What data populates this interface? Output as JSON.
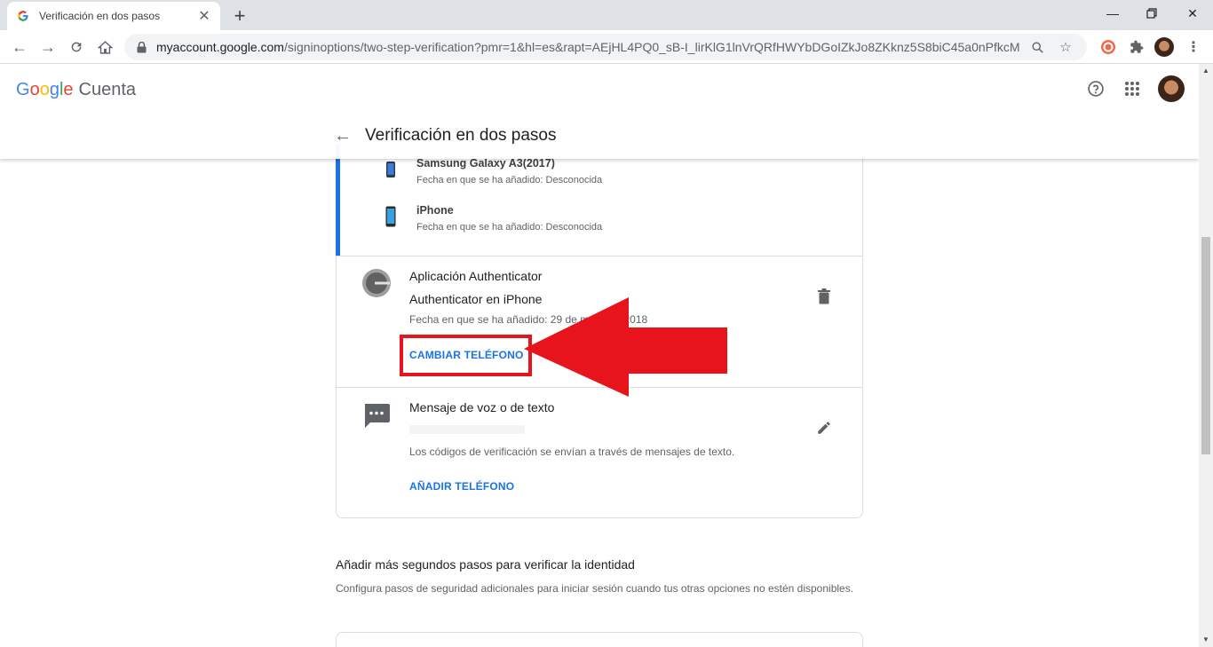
{
  "browser": {
    "tab_title": "Verificación en dos pasos",
    "url_host": "myaccount.google.com",
    "url_path": "/signinoptions/two-step-verification?pmr=1&hl=es&rapt=AEjHL4PQ0_sB-I_lirKlG1lnVrQRfHWYbDGoIZkJo8ZKknz5S8biC45a0nPfkcMlt..."
  },
  "header": {
    "logo_text": "Google",
    "product": "Cuenta",
    "page_title": "Verificación en dos pasos"
  },
  "devices": [
    {
      "name": "Samsung Galaxy A3(2017)",
      "added": "Fecha en que se ha añadido: Desconocida"
    },
    {
      "name": "iPhone",
      "added": "Fecha en que se ha añadido: Desconocida"
    }
  ],
  "authenticator": {
    "title": "Aplicación Authenticator",
    "subtitle": "Authenticator en iPhone",
    "added": "Fecha en que se ha añadido: 29 de mayo de 2018",
    "action": "CAMBIAR TELÉFONO"
  },
  "sms": {
    "title": "Mensaje de voz o de texto",
    "description": "Los códigos de verificación se envían a través de mensajes de texto.",
    "action": "AÑADIR TELÉFONO"
  },
  "more": {
    "title": "Añadir más segundos pasos para verificar la identidad",
    "description": "Configura pasos de seguridad adicionales para iniciar sesión cuando tus otras opciones no estén disponibles."
  },
  "colors": {
    "accent": "#1a73e8",
    "annotation": "#e8141c"
  }
}
